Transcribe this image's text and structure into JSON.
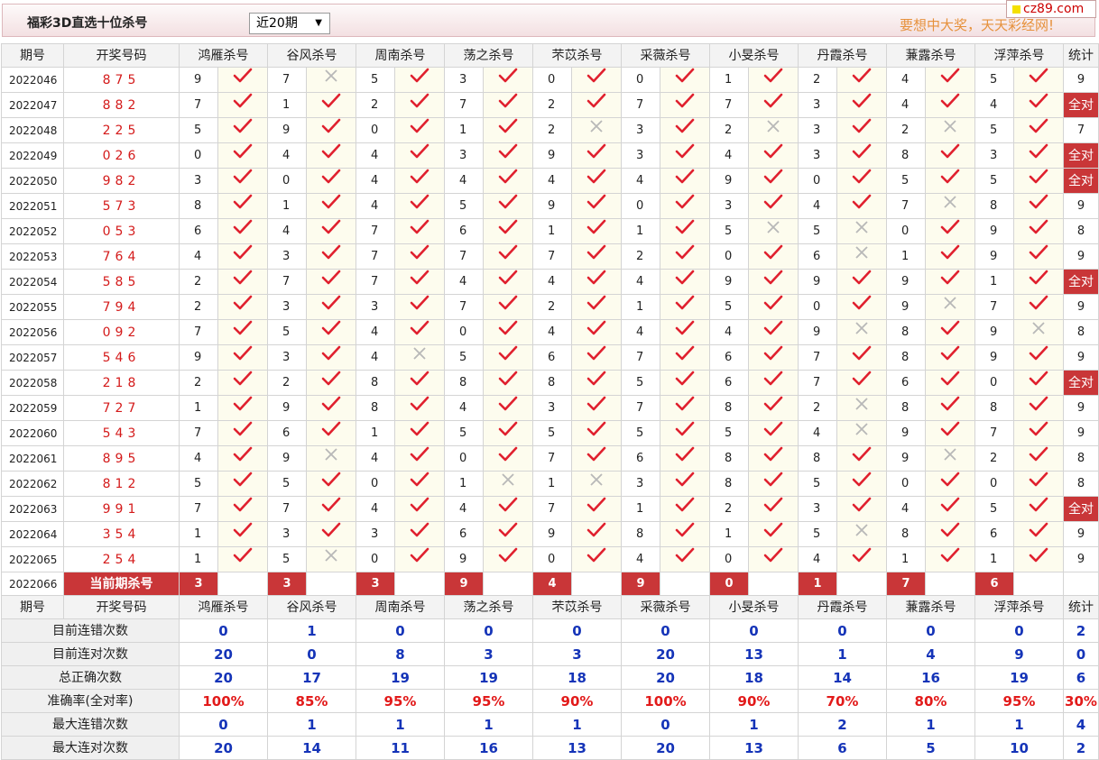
{
  "header": {
    "title": "福彩3D直选十位杀号",
    "period_select": "近20期",
    "slogan": "要想中大奖，天天彩经网!",
    "logo": "cz89.com"
  },
  "columns": {
    "issue": "期号",
    "win": "开奖号码",
    "experts": [
      "鸿雁杀号",
      "谷风杀号",
      "周南杀号",
      "荡之杀号",
      "芣苡杀号",
      "采薇杀号",
      "小旻杀号",
      "丹霞杀号",
      "蒹露杀号",
      "浮萍杀号"
    ],
    "total": "统计"
  },
  "rows": [
    {
      "issue": "2022046",
      "win": "875",
      "kills": [
        9,
        7,
        5,
        3,
        0,
        0,
        1,
        2,
        4,
        5
      ],
      "hits": [
        1,
        0,
        1,
        1,
        1,
        1,
        1,
        1,
        1,
        1
      ],
      "total": "9"
    },
    {
      "issue": "2022047",
      "win": "882",
      "kills": [
        7,
        1,
        2,
        7,
        2,
        7,
        7,
        3,
        4,
        4
      ],
      "hits": [
        1,
        1,
        1,
        1,
        1,
        1,
        1,
        1,
        1,
        1
      ],
      "total": "全对"
    },
    {
      "issue": "2022048",
      "win": "225",
      "kills": [
        5,
        9,
        0,
        1,
        2,
        3,
        2,
        3,
        2,
        5
      ],
      "hits": [
        1,
        1,
        1,
        1,
        0,
        1,
        0,
        1,
        0,
        1
      ],
      "total": "7"
    },
    {
      "issue": "2022049",
      "win": "026",
      "kills": [
        0,
        4,
        4,
        3,
        9,
        3,
        4,
        3,
        8,
        3
      ],
      "hits": [
        1,
        1,
        1,
        1,
        1,
        1,
        1,
        1,
        1,
        1
      ],
      "total": "全对"
    },
    {
      "issue": "2022050",
      "win": "982",
      "kills": [
        3,
        0,
        4,
        4,
        4,
        4,
        9,
        0,
        5,
        5
      ],
      "hits": [
        1,
        1,
        1,
        1,
        1,
        1,
        1,
        1,
        1,
        1
      ],
      "total": "全对"
    },
    {
      "issue": "2022051",
      "win": "573",
      "kills": [
        8,
        1,
        4,
        5,
        9,
        0,
        3,
        4,
        7,
        8
      ],
      "hits": [
        1,
        1,
        1,
        1,
        1,
        1,
        1,
        1,
        0,
        1
      ],
      "total": "9"
    },
    {
      "issue": "2022052",
      "win": "053",
      "kills": [
        6,
        4,
        7,
        6,
        1,
        1,
        5,
        5,
        0,
        9
      ],
      "hits": [
        1,
        1,
        1,
        1,
        1,
        1,
        0,
        0,
        1,
        1
      ],
      "total": "8"
    },
    {
      "issue": "2022053",
      "win": "764",
      "kills": [
        4,
        3,
        7,
        7,
        7,
        2,
        0,
        6,
        1,
        9
      ],
      "hits": [
        1,
        1,
        1,
        1,
        1,
        1,
        1,
        0,
        1,
        1
      ],
      "total": "9"
    },
    {
      "issue": "2022054",
      "win": "585",
      "kills": [
        2,
        7,
        7,
        4,
        4,
        4,
        9,
        9,
        9,
        1
      ],
      "hits": [
        1,
        1,
        1,
        1,
        1,
        1,
        1,
        1,
        1,
        1
      ],
      "total": "全对"
    },
    {
      "issue": "2022055",
      "win": "794",
      "kills": [
        2,
        3,
        3,
        7,
        2,
        1,
        5,
        0,
        9,
        7
      ],
      "hits": [
        1,
        1,
        1,
        1,
        1,
        1,
        1,
        1,
        0,
        1
      ],
      "total": "9"
    },
    {
      "issue": "2022056",
      "win": "092",
      "kills": [
        7,
        5,
        4,
        0,
        4,
        4,
        4,
        9,
        8,
        9
      ],
      "hits": [
        1,
        1,
        1,
        1,
        1,
        1,
        1,
        0,
        1,
        0
      ],
      "total": "8"
    },
    {
      "issue": "2022057",
      "win": "546",
      "kills": [
        9,
        3,
        4,
        5,
        6,
        7,
        6,
        7,
        8,
        9
      ],
      "hits": [
        1,
        1,
        0,
        1,
        1,
        1,
        1,
        1,
        1,
        1
      ],
      "total": "9"
    },
    {
      "issue": "2022058",
      "win": "218",
      "kills": [
        2,
        2,
        8,
        8,
        8,
        5,
        6,
        7,
        6,
        0
      ],
      "hits": [
        1,
        1,
        1,
        1,
        1,
        1,
        1,
        1,
        1,
        1
      ],
      "total": "全对"
    },
    {
      "issue": "2022059",
      "win": "727",
      "kills": [
        1,
        9,
        8,
        4,
        3,
        7,
        8,
        2,
        8,
        8
      ],
      "hits": [
        1,
        1,
        1,
        1,
        1,
        1,
        1,
        0,
        1,
        1
      ],
      "total": "9"
    },
    {
      "issue": "2022060",
      "win": "543",
      "kills": [
        7,
        6,
        1,
        5,
        5,
        5,
        5,
        4,
        9,
        7
      ],
      "hits": [
        1,
        1,
        1,
        1,
        1,
        1,
        1,
        0,
        1,
        1
      ],
      "total": "9"
    },
    {
      "issue": "2022061",
      "win": "895",
      "kills": [
        4,
        9,
        4,
        0,
        7,
        6,
        8,
        8,
        9,
        2
      ],
      "hits": [
        1,
        0,
        1,
        1,
        1,
        1,
        1,
        1,
        0,
        1
      ],
      "total": "8"
    },
    {
      "issue": "2022062",
      "win": "812",
      "kills": [
        5,
        5,
        0,
        1,
        1,
        3,
        8,
        5,
        0,
        0
      ],
      "hits": [
        1,
        1,
        1,
        0,
        0,
        1,
        1,
        1,
        1,
        1
      ],
      "total": "8"
    },
    {
      "issue": "2022063",
      "win": "991",
      "kills": [
        7,
        7,
        4,
        4,
        7,
        1,
        2,
        3,
        4,
        5
      ],
      "hits": [
        1,
        1,
        1,
        1,
        1,
        1,
        1,
        1,
        1,
        1
      ],
      "total": "全对"
    },
    {
      "issue": "2022064",
      "win": "354",
      "kills": [
        1,
        3,
        3,
        6,
        9,
        8,
        1,
        5,
        8,
        6
      ],
      "hits": [
        1,
        1,
        1,
        1,
        1,
        1,
        1,
        0,
        1,
        1
      ],
      "total": "9"
    },
    {
      "issue": "2022065",
      "win": "254",
      "kills": [
        1,
        5,
        0,
        9,
        0,
        4,
        0,
        4,
        1,
        1
      ],
      "hits": [
        1,
        0,
        1,
        1,
        1,
        1,
        1,
        1,
        1,
        1
      ],
      "total": "9"
    }
  ],
  "current": {
    "issue": "2022066",
    "label": "当前期杀号",
    "kills": [
      "3",
      "3",
      "3",
      "9",
      "4",
      "9",
      "0",
      "1",
      "7",
      "6"
    ]
  },
  "stats": [
    {
      "label": "目前连错次数",
      "values": [
        "0",
        "1",
        "0",
        "0",
        "0",
        "0",
        "0",
        "0",
        "0",
        "0"
      ],
      "total": "2"
    },
    {
      "label": "目前连对次数",
      "values": [
        "20",
        "0",
        "8",
        "3",
        "3",
        "20",
        "13",
        "1",
        "4",
        "9"
      ],
      "total": "0"
    },
    {
      "label": "总正确次数",
      "values": [
        "20",
        "17",
        "19",
        "19",
        "18",
        "20",
        "18",
        "14",
        "16",
        "19"
      ],
      "total": "6"
    },
    {
      "label": "准确率(全对率)",
      "values": [
        "100%",
        "85%",
        "95%",
        "95%",
        "90%",
        "100%",
        "90%",
        "70%",
        "80%",
        "95%"
      ],
      "total": "30%",
      "red": true
    },
    {
      "label": "最大连错次数",
      "values": [
        "0",
        "1",
        "1",
        "1",
        "1",
        "0",
        "1",
        "2",
        "1",
        "1"
      ],
      "total": "4"
    },
    {
      "label": "最大连对次数",
      "values": [
        "20",
        "14",
        "11",
        "16",
        "13",
        "20",
        "13",
        "6",
        "5",
        "10"
      ],
      "total": "2"
    }
  ],
  "icons": {
    "hit": "check-icon",
    "miss": "cross-icon"
  },
  "colors": {
    "accent_red": "#c93638",
    "check_red": "#e0202e",
    "cross_gray": "#b8b8b8",
    "stat_blue": "#1534b8",
    "slogan_orange": "#e6913c"
  }
}
